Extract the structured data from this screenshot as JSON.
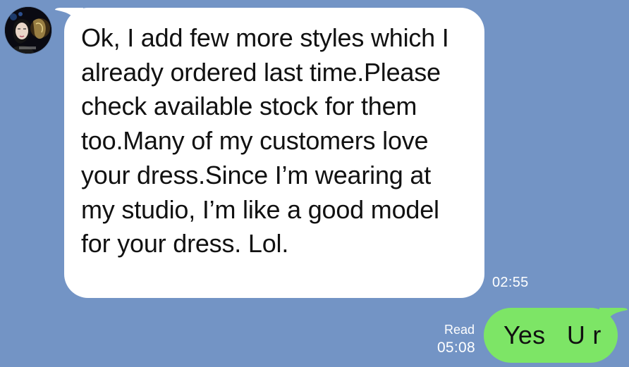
{
  "colors": {
    "chat_background": "#7394c5",
    "incoming_bubble": "#ffffff",
    "outgoing_bubble": "#7de566",
    "meta_text": "#ffffff",
    "message_text": "#111111"
  },
  "contact": {
    "avatar_icon": "contact-avatar"
  },
  "messages": [
    {
      "direction": "incoming",
      "text": "Ok, I add few more styles which I already ordered last time.Please check available stock for them too.Many of my customers love your dress.Since I’m wearing at my studio, I’m like a good model for your dress. Lol.",
      "time": "02:55"
    },
    {
      "direction": "outgoing",
      "text": "Yes   U r",
      "status": "Read",
      "time": "05:08"
    }
  ]
}
